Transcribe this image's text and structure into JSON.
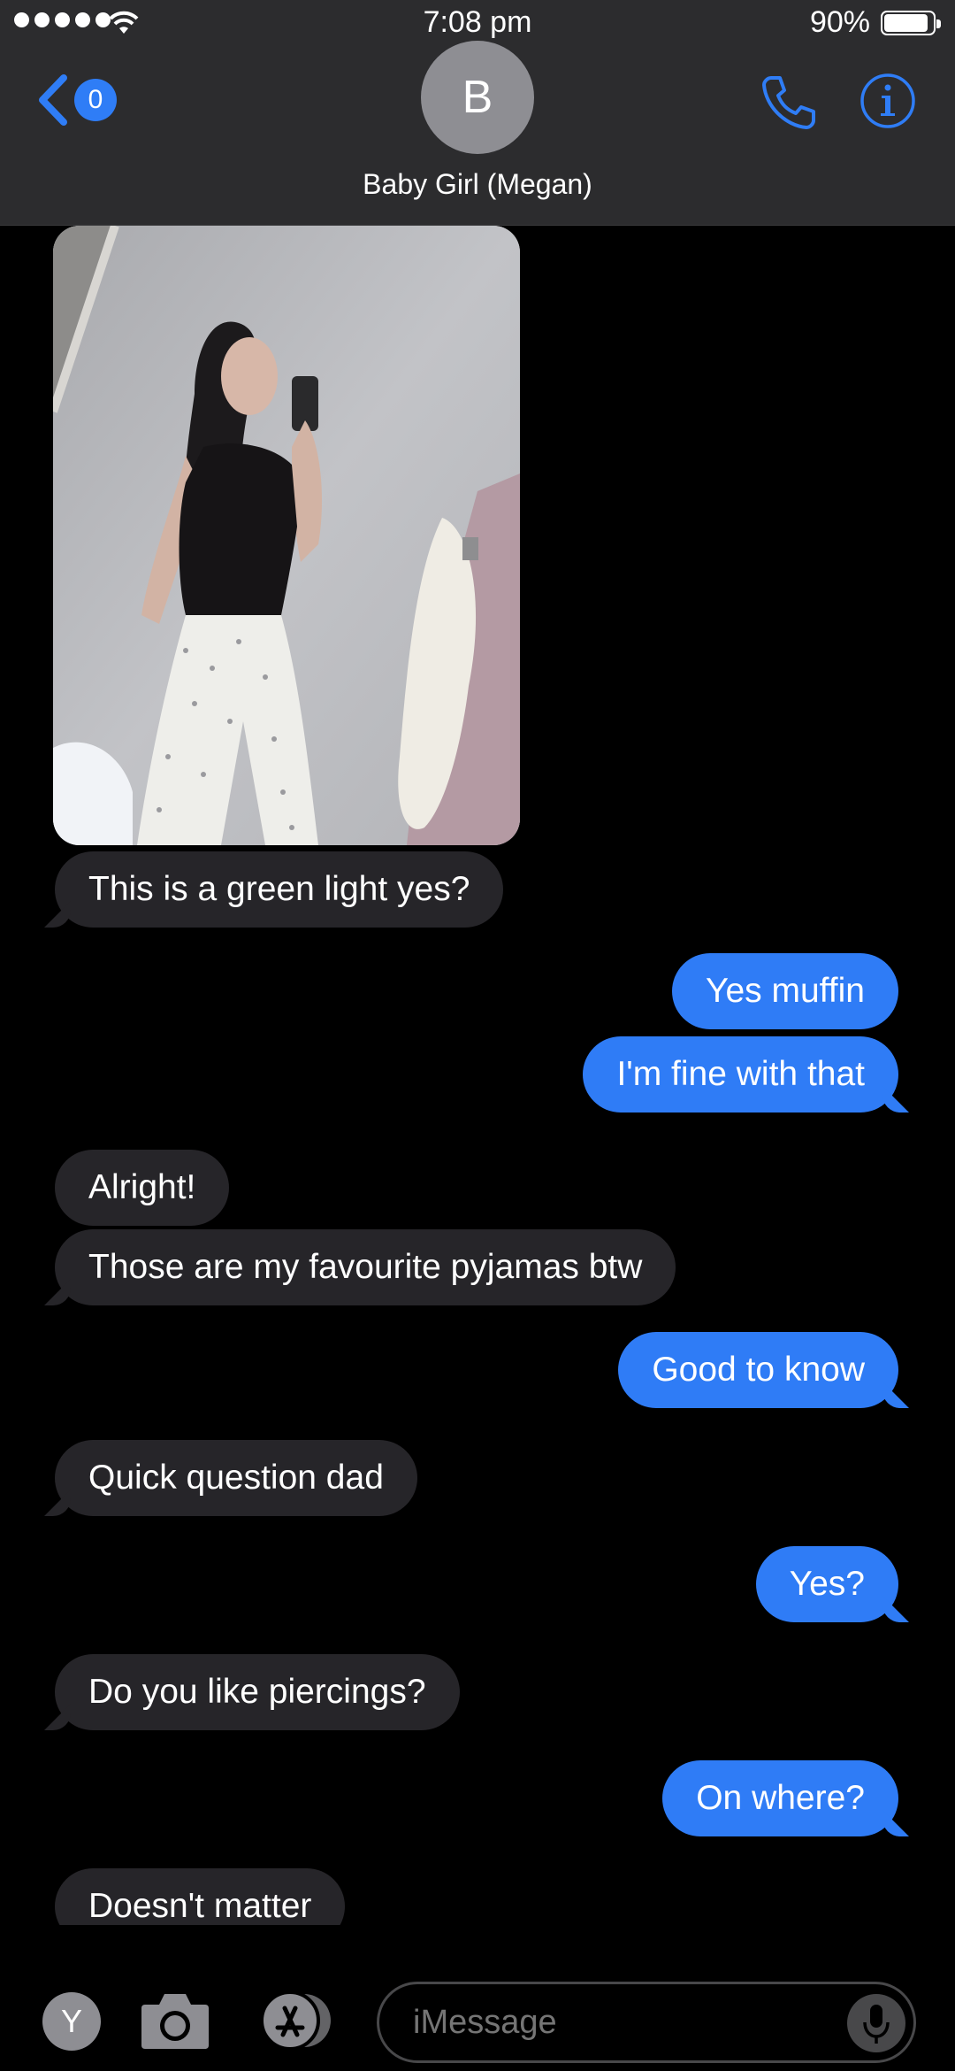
{
  "status_bar": {
    "time": "7:08 pm",
    "battery": "90%",
    "battery_level": 0.9
  },
  "header": {
    "back_count": "0",
    "avatar_initial": "B",
    "contact_name": "Baby Girl (Megan)",
    "accent_color": "#2f7df6"
  },
  "messages": [
    {
      "side": "in",
      "text": "This is a green light yes?"
    },
    {
      "side": "out",
      "text": "Yes muffin"
    },
    {
      "side": "out",
      "text": "I'm fine with that"
    },
    {
      "side": "in",
      "text": "Alright!"
    },
    {
      "side": "in",
      "text": "Those are my favourite pyjamas btw"
    },
    {
      "side": "out",
      "text": "Good to know"
    },
    {
      "side": "in",
      "text": "Quick question dad"
    },
    {
      "side": "out",
      "text": "Yes?"
    },
    {
      "side": "in",
      "text": "Do you like piercings?"
    },
    {
      "side": "out",
      "text": "On where?"
    },
    {
      "side": "in",
      "text": "Doesn't matter"
    }
  ],
  "input_bar": {
    "apps_initial": "Y",
    "placeholder": "iMessage"
  }
}
